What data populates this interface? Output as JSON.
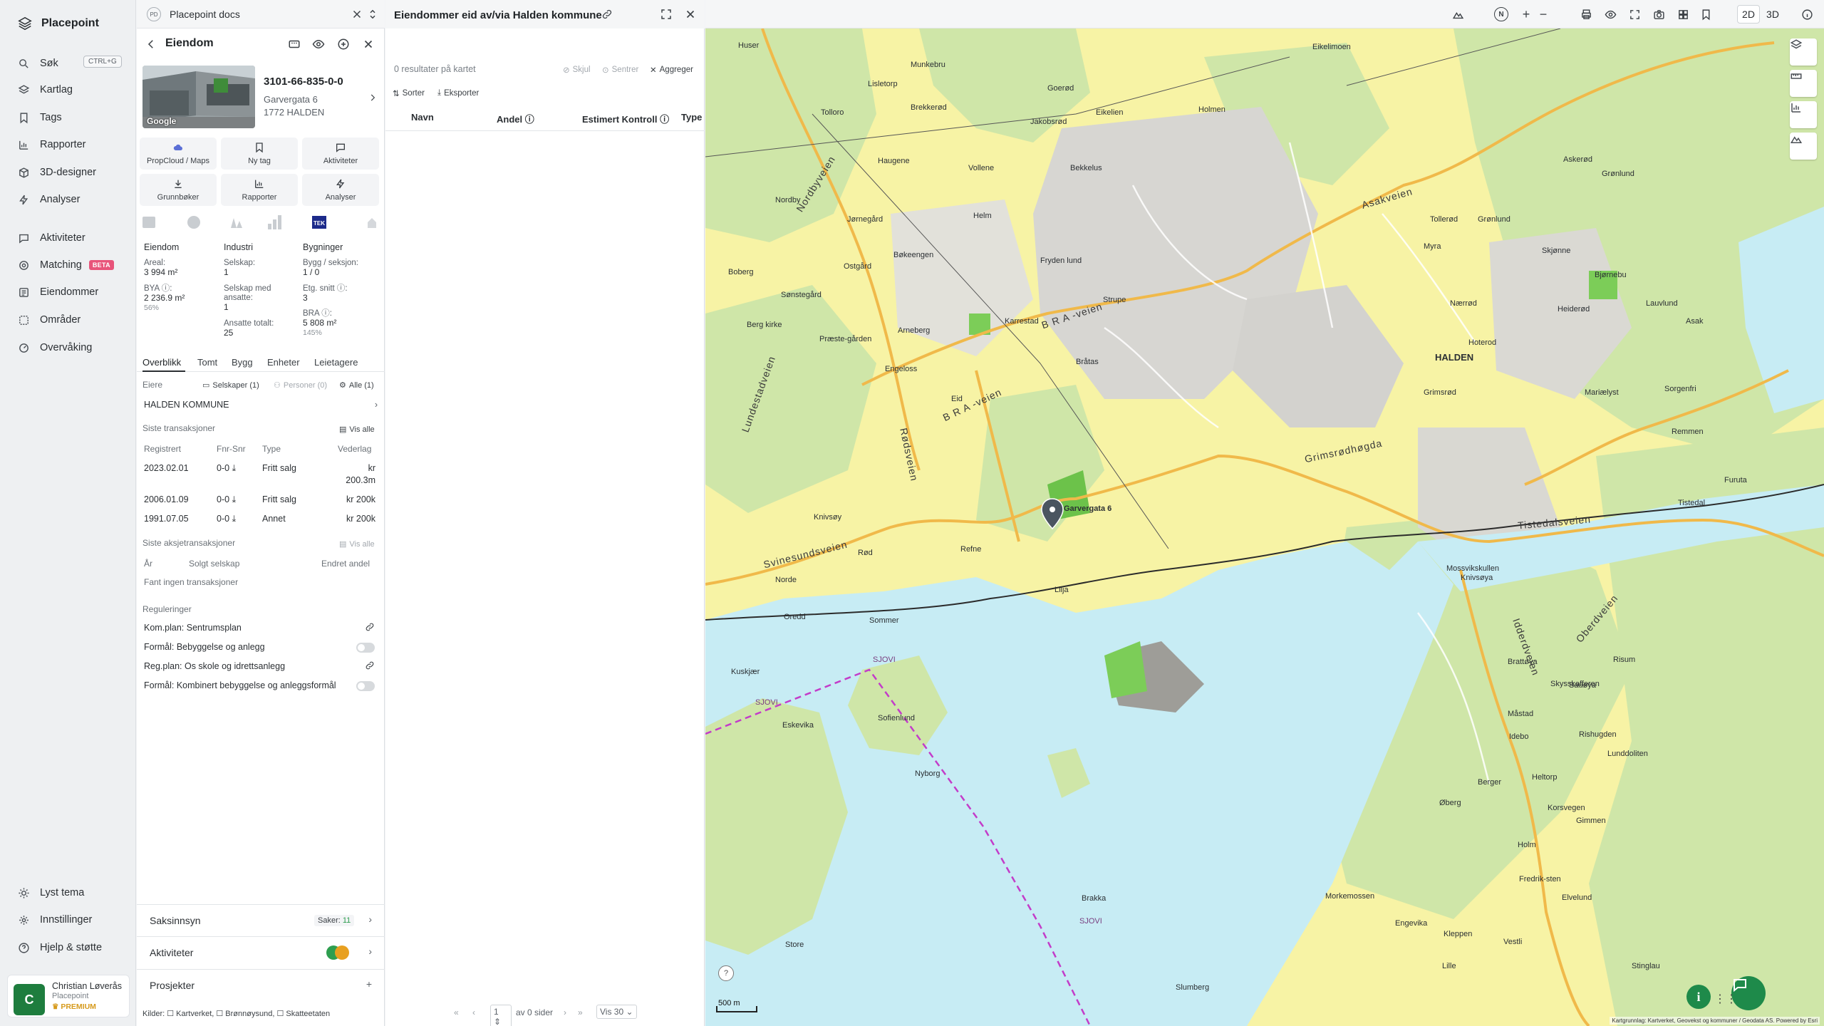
{
  "nav": {
    "brand": "Placepoint",
    "search_shortcut": "CTRL+G",
    "items_top": [
      {
        "label": "Søk",
        "icon": "search-icon"
      },
      {
        "label": "Kartlag",
        "icon": "layers-icon"
      },
      {
        "label": "Tags",
        "icon": "bookmark-icon"
      },
      {
        "label": "Rapporter",
        "icon": "chart-icon"
      },
      {
        "label": "3D-designer",
        "icon": "cube-icon"
      },
      {
        "label": "Analyser",
        "icon": "bolt-icon"
      }
    ],
    "items_mid": [
      {
        "label": "Aktiviteter",
        "icon": "chat-icon"
      },
      {
        "label": "Matching",
        "icon": "target-icon",
        "badge": "BETA"
      },
      {
        "label": "Eiendommer",
        "icon": "list-icon"
      },
      {
        "label": "Områder",
        "icon": "dashed-square-icon"
      },
      {
        "label": "Overvåking",
        "icon": "monitor-icon"
      }
    ],
    "items_bottom": [
      {
        "label": "Lyst tema",
        "icon": "sun-icon"
      },
      {
        "label": "Innstillinger",
        "icon": "gear-icon"
      },
      {
        "label": "Hjelp & støtte",
        "icon": "help-icon"
      }
    ],
    "user": {
      "initial": "C",
      "name": "Christian Løverås",
      "org": "Placepoint",
      "plan": "PREMIUM"
    }
  },
  "property": {
    "docs_badge": "PD",
    "docs_title": "Placepoint docs",
    "header": "Eiendom",
    "image_label": "Google",
    "id": "3101-66-835-0-0",
    "street": "Garvergata 6",
    "postal": "1772 HALDEN",
    "tiles": [
      {
        "label": "PropCloud / Maps",
        "icon": "cloud-icon"
      },
      {
        "label": "Ny tag",
        "icon": "bookmark-icon"
      },
      {
        "label": "Aktiviteter",
        "icon": "chat-icon"
      },
      {
        "label": "Grunnbøker",
        "icon": "download-icon"
      },
      {
        "label": "Rapporter",
        "icon": "chart-icon"
      },
      {
        "label": "Analyser",
        "icon": "bolt-icon"
      }
    ],
    "tek_badge": "TEK",
    "stats": {
      "col1_title": "Eiendom",
      "areal_label": "Areal:",
      "areal_value": "3 994 m²",
      "bya_label": "BYA ⓘ:",
      "bya_value": "2 236.9 m²",
      "bya_pct": "56%",
      "col2_title": "Industri",
      "selskap_label": "Selskap:",
      "selskap_value": "1",
      "ansatte_label": "Selskap med ansatte:",
      "ansatte_value": "1",
      "ansatte_tot_label": "Ansatte totalt:",
      "ansatte_tot_value": "25",
      "col3_title": "Bygninger",
      "bygg_label": "Bygg / seksjon:",
      "bygg_value": "1 / 0",
      "etg_label": "Etg. snitt ⓘ:",
      "etg_value": "3",
      "bra_label": "BRA ⓘ:",
      "bra_value": "5 808 m²",
      "bra_pct": "145%"
    },
    "tabs": [
      "Overblikk",
      "Tomt",
      "Bygg",
      "Enheter",
      "Leietagere"
    ],
    "owners": {
      "label": "Eiere",
      "chip_companies": "Selskaper (1)",
      "chip_persons": "Personer (0)",
      "chip_all": "Alle (1)",
      "owner": "HALDEN KOMMUNE"
    },
    "transactions": {
      "title": "Siste transaksjoner",
      "show_all": "Vis alle",
      "headers": [
        "Registrert",
        "Fnr-Snr",
        "Type",
        "Vederlag"
      ],
      "rows": [
        {
          "date": "2023.02.01",
          "nr": "0-0",
          "type": "Fritt salg",
          "value1": "kr",
          "value2": "200.3m"
        },
        {
          "date": "2006.01.09",
          "nr": "0-0",
          "type": "Fritt salg",
          "value1": "kr 200k",
          "value2": ""
        },
        {
          "date": "1991.07.05",
          "nr": "0-0",
          "type": "Annet",
          "value1": "kr 200k",
          "value2": ""
        }
      ]
    },
    "share_tx": {
      "title": "Siste aksjetransaksjoner",
      "show_all": "Vis alle",
      "headers": [
        "År",
        "Solgt selskap",
        "Endret andel"
      ],
      "empty": "Fant ingen transaksjoner"
    },
    "regulations": {
      "title": "Reguleringer",
      "items": [
        {
          "label": "Kom.plan: Sentrumsplan",
          "control": "link"
        },
        {
          "label": "Formål: Bebyggelse og anlegg",
          "control": "toggle"
        },
        {
          "label": "Reg.plan: Os skole og idrettsanlegg",
          "control": "link"
        },
        {
          "label": "Formål: Kombinert bebyggelse og anleggsformål",
          "control": "toggle"
        }
      ]
    },
    "accordions": {
      "saksinnsyn": "Saksinnsyn",
      "saker_label": "Saker:",
      "saker_count": "11",
      "aktiviteter": "Aktiviteter",
      "prosjekter": "Prosjekter",
      "add": "+"
    },
    "sources": "Kilder: ☐ Kartverket, ☐ Brønnøysund, ☐ Skatteetaten"
  },
  "list": {
    "title": "Eiendommer eid av/via Halden kommune",
    "subtitle": "0 resultater på kartet",
    "actions": {
      "hide": "Skjul",
      "center": "Sentrer",
      "aggregate": "Aggreger",
      "sort": "Sorter",
      "export": "Eksporter"
    },
    "columns": [
      "Navn",
      "Andel ⓘ",
      "Estimert Kontroll ⓘ",
      "Type"
    ],
    "pager": {
      "page": "1",
      "of": "av 0 sider",
      "per_page": "Vis 30"
    }
  },
  "map": {
    "mode_2d": "2D",
    "mode_3d": "3D",
    "north": "N",
    "scale": "500 m",
    "attribution": "Kartgrunnlag: Kartverket, Geovekst og kommuner / Geodata AS. Powered by Esri",
    "labels": {
      "places": [
        "Huser",
        "Munkebru",
        "Eikelimoen",
        "Goerød",
        "Brekkerød",
        "Jakobsrød",
        "Eikelien",
        "Holmen",
        "Lisletorp",
        "Tolloro",
        "Haugene",
        "Bekkelus",
        "Vollene",
        "Askerød",
        "Grønlund",
        "Nordby",
        "Jørnegård",
        "Helm",
        "Tollerød",
        "Grønlund",
        "Myra",
        "Boberg",
        "Bøkeengen",
        "Ostgård",
        "Fryden lund",
        "Skjønne",
        "Bjørnebu",
        "Sønstegård",
        "Strupe",
        "Nærrød",
        "Heiderød",
        "Lauvlund",
        "Asak",
        "Berg kirke",
        "Præste-gården",
        "Arneberg",
        "Karrestad",
        "Hoterod",
        "Bråtas",
        "Engeloss",
        "Eid",
        "Grimsrød",
        "Mariælyst",
        "Sorgenfri",
        "Remmen",
        "Furuta",
        "Tistedal",
        "Knivsøy",
        "Rød",
        "Refne",
        "Norde",
        "Lilja",
        "Sommer",
        "Oredd",
        "Knivsøya",
        "Mossvikskullen",
        "Brattøya",
        "Sauøya",
        "Risum",
        "Kuskjær",
        "Eskevika",
        "Sofienlund",
        "Måstad",
        "Skysskafferen",
        "Nyborg",
        "Øberg",
        "Idebo",
        "Rishugden",
        "Brakka",
        "Lunddoliten",
        "Heltorp",
        "Korsvegen",
        "Berger",
        "Holm",
        "Gimmen",
        "Morkemossen",
        "Engevika",
        "Kleppen",
        "Lille",
        "Vestli",
        "Store",
        "Slumberg",
        "Stinglau",
        "Fredrik-sten",
        "Elvelund"
      ],
      "city": "HALDEN",
      "roads": [
        "Nordbyveien",
        "B R A -veien",
        "B R A -veien",
        "Svinesundsveien",
        "Tistedalsveien",
        "Grimsrødhøgda",
        "Lundestadveien",
        "Asakveien",
        "Idderdveien",
        "Oberdveien",
        "Rødsveien"
      ],
      "marker_label": "Garvergata 6",
      "water": [
        "SJOVI",
        "SJOVI",
        "SJOVI"
      ]
    }
  }
}
